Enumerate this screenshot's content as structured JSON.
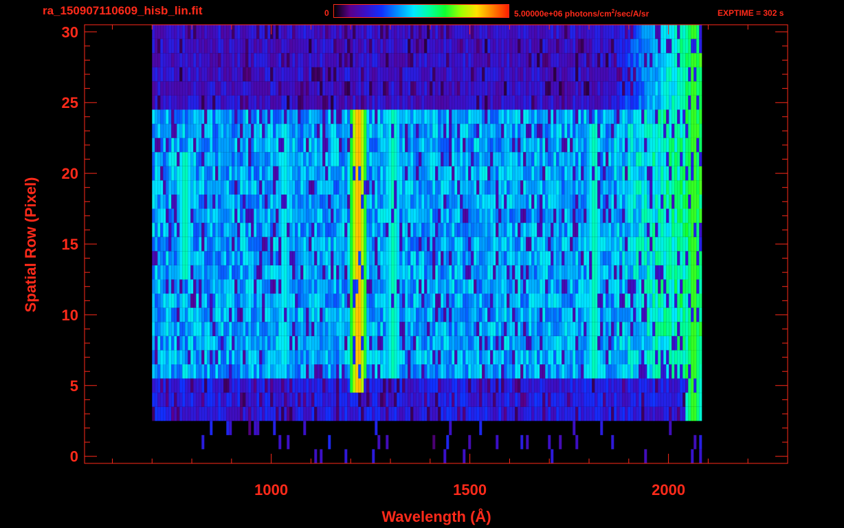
{
  "header": {
    "file_name": "ra_150907110609_hisb_lin.fit",
    "colorbar_min_label": "0",
    "colorbar_max_value": "5.00000e+06 photons/cm",
    "colorbar_max_exp": "2",
    "colorbar_max_units": "/sec/A/sr",
    "exptime": "EXPTIME = 302 s"
  },
  "colors": {
    "foreground": "#ff2a1a",
    "background": "#000000",
    "colormap": [
      "#000000",
      "#5a008a",
      "#3a10c8",
      "#1030ff",
      "#0090ff",
      "#00e8ff",
      "#00ffa0",
      "#10ff30",
      "#a0ff00",
      "#ffe000",
      "#ff8000",
      "#ff2000"
    ]
  },
  "chart_data": {
    "type": "heatmap",
    "title": "ra_150907110609_hisb_lin.fit",
    "xlabel": "Wavelength (Å)",
    "ylabel": "Spatial Row (Pixel)",
    "xlim": [
      530,
      2300
    ],
    "ylim": [
      -0.5,
      30.5
    ],
    "xticks": [
      1000,
      1500,
      2000
    ],
    "yticks": [
      0,
      5,
      10,
      15,
      20,
      25,
      30
    ],
    "x_tick_labels": [
      "1000",
      "1500",
      "2000"
    ],
    "y_tick_labels": [
      "0",
      "5",
      "10",
      "15",
      "20",
      "25",
      "30"
    ],
    "zlim": [
      0,
      5000000
    ],
    "zunits": "photons/cm^2/sec/A/sr",
    "data_extent_x": [
      700,
      2080
    ],
    "rows_with_signal": [
      3,
      30
    ],
    "features": [
      {
        "wavelength": 1216,
        "rows": [
          5,
          24
        ],
        "level": 0.9
      },
      {
        "wavelength": 1304,
        "rows": [
          6,
          24
        ],
        "level": 0.55
      },
      {
        "wavelength": 1810,
        "rows": [
          6,
          23
        ],
        "level": 0.55
      },
      {
        "wavelength": 2060,
        "rows": [
          2,
          30
        ],
        "level": 0.7
      },
      {
        "wavelength": 1030,
        "rows": [
          7,
          23
        ],
        "level": 0.5
      },
      {
        "wavelength": 780,
        "rows": [
          13,
          21
        ],
        "level": 0.55
      }
    ]
  }
}
